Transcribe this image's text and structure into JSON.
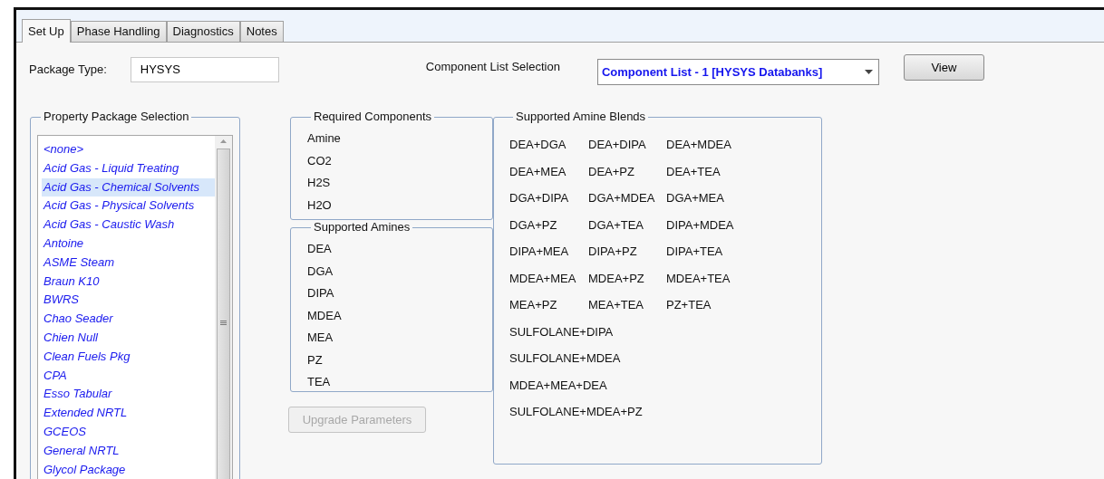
{
  "tabs": [
    {
      "label": "Set Up",
      "selected": true
    },
    {
      "label": "Phase Handling",
      "selected": false
    },
    {
      "label": "Diagnostics",
      "selected": false
    },
    {
      "label": "Notes",
      "selected": false
    }
  ],
  "package_type": {
    "label": "Package Type:",
    "value": "HYSYS"
  },
  "component_list": {
    "label": "Component List Selection",
    "value": "Component List - 1 [HYSYS Databanks]"
  },
  "view_button": "View",
  "property_package": {
    "title": "Property Package Selection",
    "items": [
      {
        "label": "<none>",
        "selected": false
      },
      {
        "label": "Acid Gas - Liquid Treating",
        "selected": false
      },
      {
        "label": "Acid Gas - Chemical Solvents",
        "selected": true
      },
      {
        "label": "Acid Gas - Physical Solvents",
        "selected": false
      },
      {
        "label": "Acid Gas - Caustic Wash",
        "selected": false
      },
      {
        "label": "Antoine",
        "selected": false
      },
      {
        "label": "ASME Steam",
        "selected": false
      },
      {
        "label": "Braun K10",
        "selected": false
      },
      {
        "label": "BWRS",
        "selected": false
      },
      {
        "label": "Chao Seader",
        "selected": false
      },
      {
        "label": "Chien Null",
        "selected": false
      },
      {
        "label": "Clean Fuels Pkg",
        "selected": false
      },
      {
        "label": "CPA",
        "selected": false
      },
      {
        "label": "Esso Tabular",
        "selected": false
      },
      {
        "label": "Extended NRTL",
        "selected": false
      },
      {
        "label": "GCEOS",
        "selected": false
      },
      {
        "label": "General NRTL",
        "selected": false
      },
      {
        "label": "Glycol Package",
        "selected": false
      }
    ]
  },
  "required_components": {
    "title": "Required Components",
    "items": [
      "Amine",
      "CO2",
      "H2S",
      "H2O"
    ]
  },
  "supported_amines": {
    "title": "Supported Amines",
    "items": [
      "DEA",
      "DGA",
      "DIPA",
      "MDEA",
      "MEA",
      "PZ",
      "TEA"
    ]
  },
  "upgrade_button": {
    "label": "Upgrade Parameters",
    "disabled": true
  },
  "amine_blends": {
    "title": "Supported Amine Blends",
    "rows": [
      [
        "DEA+DGA",
        "DEA+DIPA",
        "DEA+MDEA"
      ],
      [
        "DEA+MEA",
        "DEA+PZ",
        "DEA+TEA"
      ],
      [
        "DGA+DIPA",
        "DGA+MDEA",
        "DGA+MEA"
      ],
      [
        "DGA+PZ",
        "DGA+TEA",
        "DIPA+MDEA"
      ],
      [
        "DIPA+MEA",
        "DIPA+PZ",
        "DIPA+TEA"
      ],
      [
        "MDEA+MEA",
        "MDEA+PZ",
        "MDEA+TEA"
      ],
      [
        "MEA+PZ",
        "MEA+TEA",
        "PZ+TEA"
      ],
      [
        "SULFOLANE+DIPA"
      ],
      [
        "SULFOLANE+MDEA"
      ],
      [
        "MDEA+MEA+DEA"
      ],
      [
        "SULFOLANE+MDEA+PZ"
      ]
    ]
  }
}
